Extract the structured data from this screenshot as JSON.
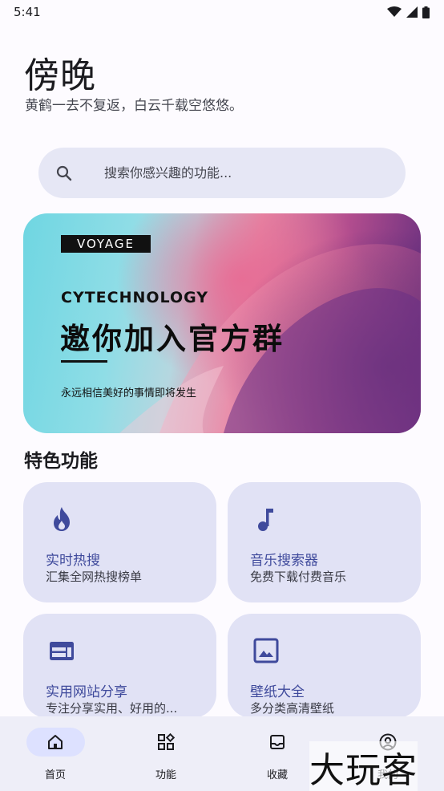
{
  "status_bar": {
    "time": "5:41",
    "icons": [
      "wifi-icon",
      "cellular-icon",
      "battery-icon"
    ]
  },
  "header": {
    "title": "傍晚",
    "subtitle": "黄鹤一去不复返，白云千载空悠悠。"
  },
  "search": {
    "placeholder": "搜索你感兴趣的功能...",
    "icon": "search-icon"
  },
  "banner": {
    "tag": "VOYAGE",
    "brand": "CYTECHNOLOGY",
    "headline": "邀你加入官方群",
    "caption": "永远相信美好的事情即将发生"
  },
  "features": {
    "title": "特色功能",
    "cards": [
      {
        "title": "实时热搜",
        "desc": "汇集全网热搜榜单",
        "icon": "flame-icon"
      },
      {
        "title": "音乐搜索器",
        "desc": "免费下载付费音乐",
        "icon": "music-note-icon"
      },
      {
        "title": "实用网站分享",
        "desc": "专注分享实用、好用的...",
        "icon": "web-icon"
      },
      {
        "title": "壁纸大全",
        "desc": "多分类高清壁纸",
        "icon": "image-icon"
      }
    ]
  },
  "bottom_nav": {
    "items": [
      {
        "label": "首页",
        "icon": "home-icon",
        "active": true
      },
      {
        "label": "功能",
        "icon": "widgets-icon",
        "active": false
      },
      {
        "label": "收藏",
        "icon": "inbox-icon",
        "active": false
      },
      {
        "label": "我的",
        "icon": "account-icon",
        "active": false
      }
    ]
  },
  "watermark": "大玩客",
  "colors": {
    "accent": "#3f4a9c",
    "card_bg": "#e1e2f5",
    "search_bg": "#e6e7f5",
    "nav_active": "#dde1ff"
  }
}
